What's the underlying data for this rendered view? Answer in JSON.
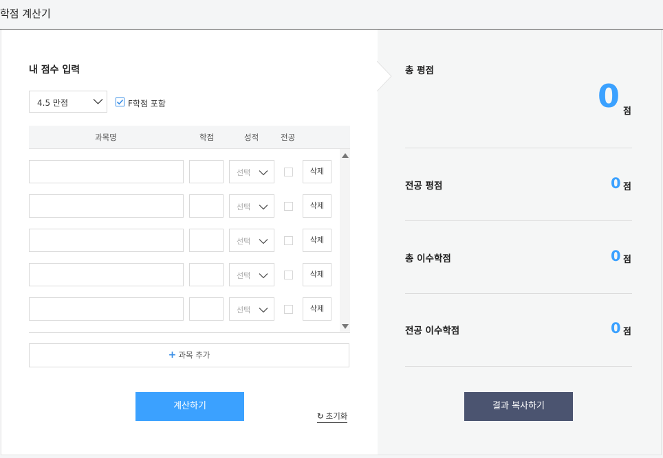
{
  "window": {
    "title": "학점 계산기"
  },
  "input_section": {
    "title": "내 점수 입력",
    "scale_select": {
      "value": "4.5 만점"
    },
    "f_grade": {
      "label": "F학점 포함",
      "checked": true
    },
    "columns": [
      "과목명",
      "학점",
      "성적",
      "전공"
    ],
    "rows": [
      {
        "grade_placeholder": "선택",
        "delete_label": "삭제"
      },
      {
        "grade_placeholder": "선택",
        "delete_label": "삭제"
      },
      {
        "grade_placeholder": "선택",
        "delete_label": "삭제"
      },
      {
        "grade_placeholder": "선택",
        "delete_label": "삭제"
      },
      {
        "grade_placeholder": "선택",
        "delete_label": "삭제"
      }
    ],
    "add_label": "과목 추가",
    "calc_label": "계산하기",
    "reset_label": "초기화"
  },
  "results": {
    "total_gpa": {
      "label": "총 평점",
      "value": "0",
      "unit": "점"
    },
    "major_gpa": {
      "label": "전공 평점",
      "value": "0",
      "unit": "점"
    },
    "total_credits": {
      "label": "총 이수학점",
      "value": "0",
      "unit": "점"
    },
    "major_credits": {
      "label": "전공 이수학점",
      "value": "0",
      "unit": "점"
    },
    "copy_label": "결과 복사하기"
  },
  "colors": {
    "accent": "#3ba1ff",
    "copy_button": "#4b5470",
    "check": "#3a8ee6"
  },
  "icons": [
    "chevron-down-icon",
    "check-icon",
    "plus-icon",
    "refresh-icon",
    "scroll-up-icon",
    "scroll-down-icon"
  ]
}
